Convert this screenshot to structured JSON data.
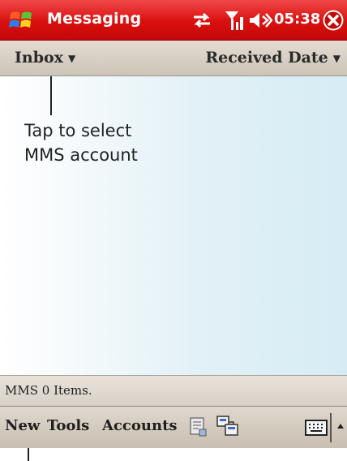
{
  "title_bar": {
    "app_title": "Messaging",
    "time": "05:38",
    "icons": [
      "windows-start-icon",
      "sync-icon",
      "signal-icon",
      "volume-icon",
      "close-icon"
    ],
    "color": "#d90f0f"
  },
  "header": {
    "folder_label": "Inbox",
    "sort_label": "Received Date"
  },
  "callout": {
    "line1": "Tap to select",
    "line2": "MMS account"
  },
  "status_bar": {
    "text": "MMS  0 Items."
  },
  "menu_bar": {
    "new_label": "New",
    "tools_label": "Tools",
    "accounts_label": "Accounts",
    "icons": [
      "send-receive-icon",
      "folder-view-icon",
      "keyboard-icon",
      "sip-arrow-icon"
    ]
  }
}
